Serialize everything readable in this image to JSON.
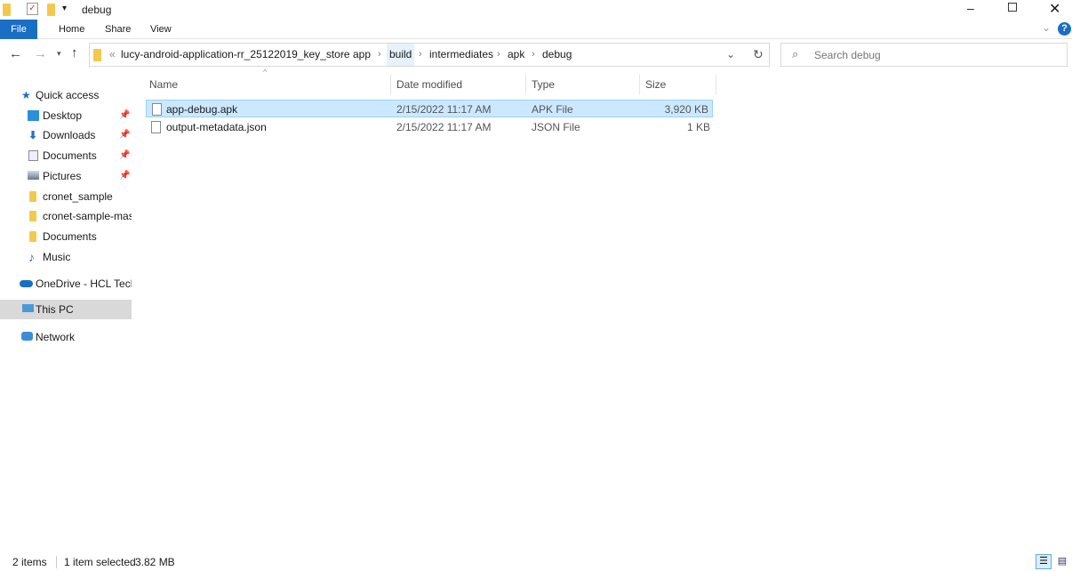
{
  "window": {
    "title": "debug"
  },
  "ribbon": {
    "tabs": [
      "File",
      "Home",
      "Share",
      "View"
    ]
  },
  "address": {
    "prefix": "«",
    "crumbs": [
      "lucy-android-application-rr_25122019_key_store",
      "app",
      "build",
      "intermediates",
      "apk",
      "debug"
    ],
    "highlighted": "build"
  },
  "search": {
    "placeholder": "Search debug"
  },
  "nav": {
    "quick_access": "Quick access",
    "items": [
      {
        "label": "Desktop",
        "icon": "desktop-icon",
        "pinned": true
      },
      {
        "label": "Downloads",
        "icon": "download-icon",
        "pinned": true
      },
      {
        "label": "Documents",
        "icon": "documents-icon",
        "pinned": true
      },
      {
        "label": "Pictures",
        "icon": "pictures-icon",
        "pinned": true
      },
      {
        "label": "cronet_sample",
        "icon": "folder-icon",
        "pinned": false
      },
      {
        "label": "cronet-sample-mast",
        "icon": "folder-icon",
        "pinned": false
      },
      {
        "label": "Documents",
        "icon": "folder-icon",
        "pinned": false
      },
      {
        "label": "Music",
        "icon": "music-icon",
        "pinned": false
      }
    ],
    "onedrive": "OneDrive - HCL Techr",
    "this_pc": "This PC",
    "network": "Network"
  },
  "columns": [
    "Name",
    "Date modified",
    "Type",
    "Size"
  ],
  "files": [
    {
      "name": "app-debug.apk",
      "date": "2/15/2022 11:17 AM",
      "type": "APK File",
      "size": "3,920 KB",
      "selected": true
    },
    {
      "name": "output-metadata.json",
      "date": "2/15/2022 11:17 AM",
      "type": "JSON File",
      "size": "1 KB",
      "selected": false
    }
  ],
  "status": {
    "count": "2 items",
    "selected": "1 item selected",
    "size": "3.82 MB"
  },
  "colors": {
    "accent": "#1a6fc4",
    "selection": "#cce8ff"
  }
}
